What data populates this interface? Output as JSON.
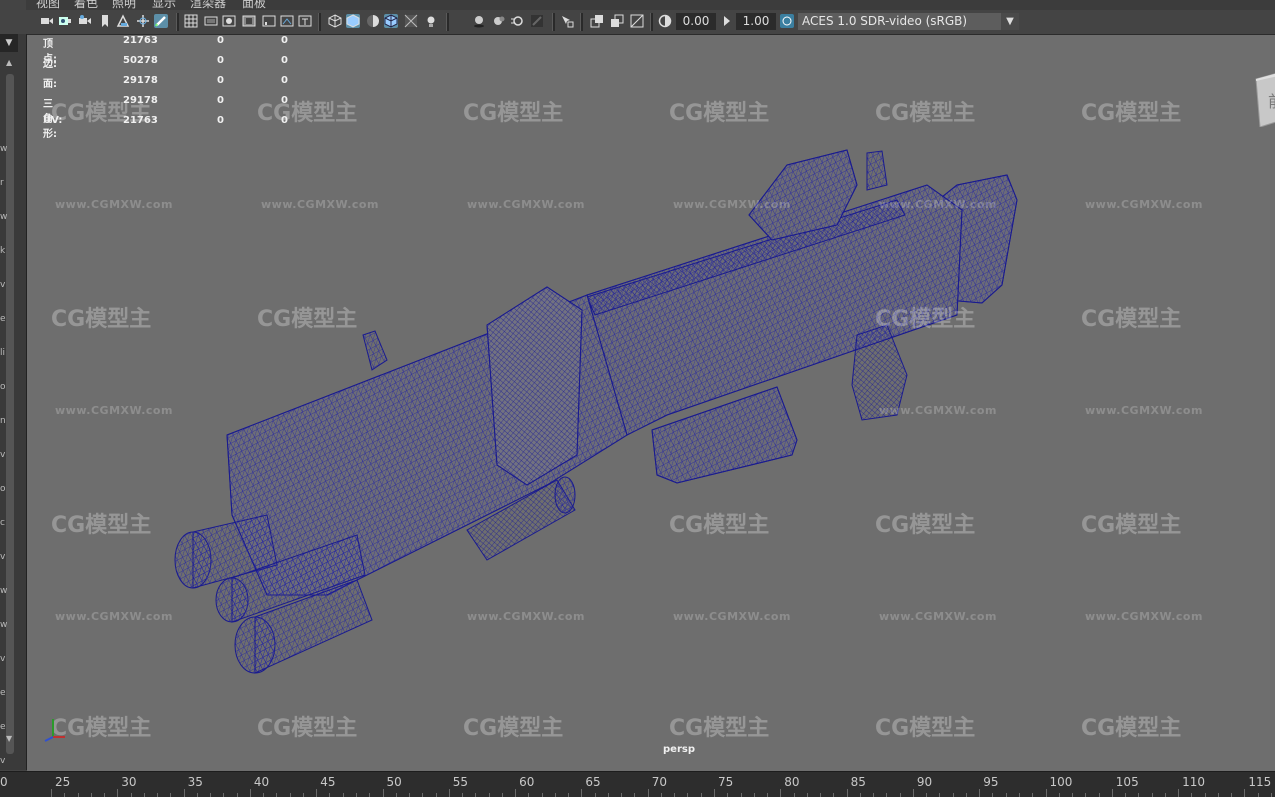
{
  "menu": [
    "视图",
    "着色",
    "照明",
    "显示",
    "渲染器",
    "面板"
  ],
  "toolbar": {
    "field_a": "0.00",
    "field_b": "1.00",
    "color_space": "ACES 1.0 SDR-video (sRGB)"
  },
  "hud": {
    "rows": [
      {
        "label": "顶点:",
        "v1": "21763",
        "v2": "0",
        "v3": "0"
      },
      {
        "label": "边:",
        "v1": "50278",
        "v2": "0",
        "v3": "0"
      },
      {
        "label": "面:",
        "v1": "29178",
        "v2": "0",
        "v3": "0"
      },
      {
        "label": "三角形:",
        "v1": "29178",
        "v2": "0",
        "v3": "0"
      },
      {
        "label": "UV:",
        "v1": "21763",
        "v2": "0",
        "v3": "0"
      }
    ]
  },
  "viewport": {
    "camera": "persp",
    "viewcube_face": "前"
  },
  "watermark": {
    "logo": "CG模型主",
    "url": "www.CGMXW.com"
  },
  "timeline": {
    "start_label": "0",
    "ticks": [
      "25",
      "30",
      "35",
      "40",
      "45",
      "50",
      "55",
      "60",
      "65",
      "70",
      "75",
      "80",
      "85",
      "90",
      "95",
      "100",
      "105",
      "110",
      "115"
    ]
  },
  "left_fragments": [
    "w",
    "r",
    "w",
    "k",
    "v",
    "e",
    "li",
    "o",
    "n",
    "v",
    "o",
    "c",
    "v",
    "w",
    "w",
    "v",
    "e",
    "e",
    "v"
  ],
  "colors": {
    "wire": "#1e1f9a",
    "viewport_bg": "#6e6e6e",
    "active_tool": "#5c8fa8"
  }
}
